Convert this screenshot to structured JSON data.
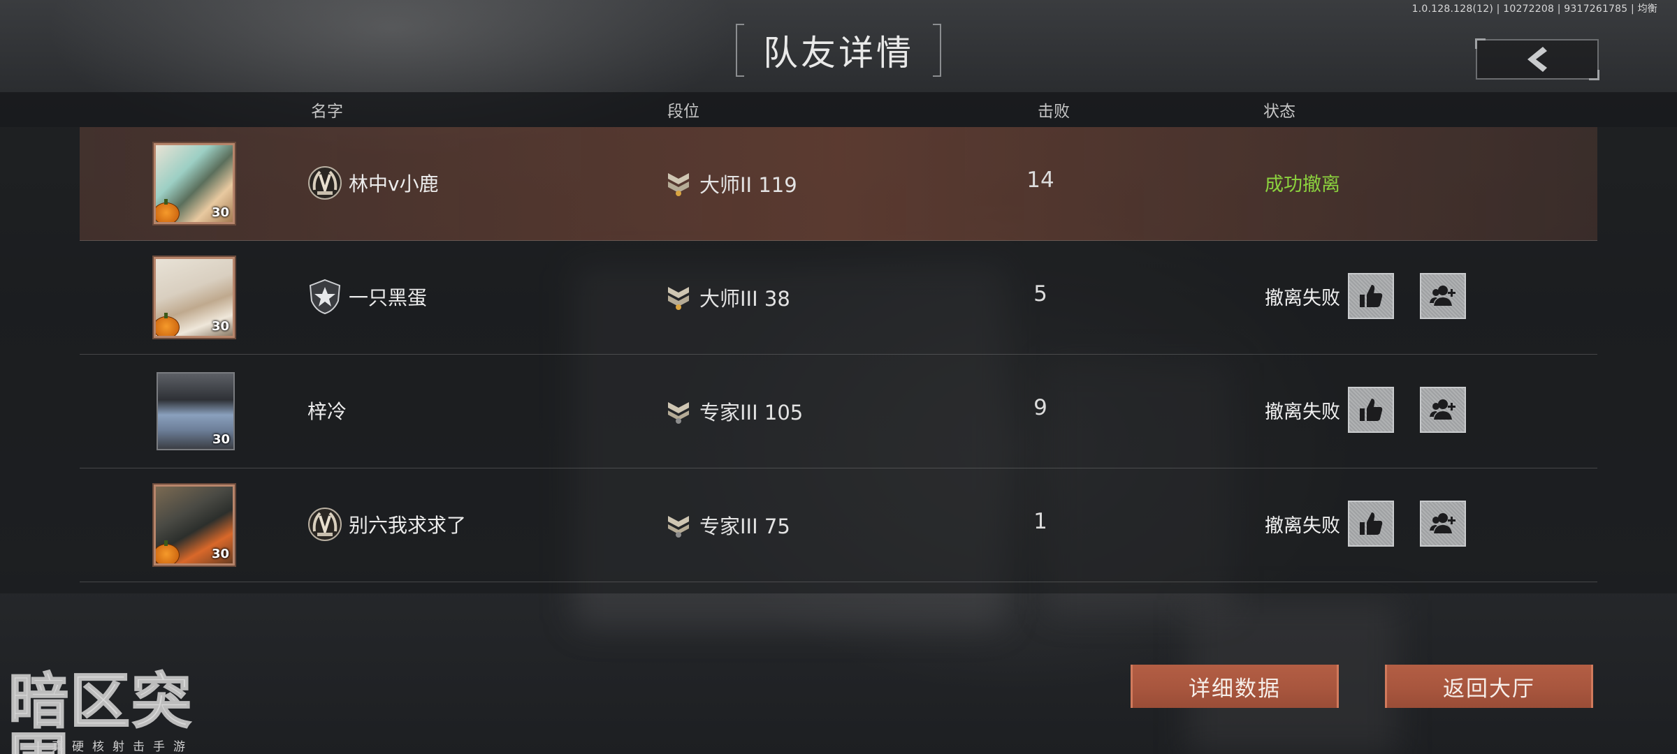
{
  "version_info": "1.0.128.128(12) | 10272208 | 9317261785 | 均衡",
  "title": "队友详情",
  "back_icon": "chevron-left-icon",
  "columns": {
    "name": "名字",
    "rank": "段位",
    "kills": "击败",
    "status": "状态"
  },
  "players": [
    {
      "name": "林中v小鹿",
      "badge_icon": "laurel-badge-icon",
      "level": "30",
      "rank": "大师II 119",
      "kills": "14",
      "status": "成功撤离",
      "status_color": "#8bd23e",
      "highlighted": true,
      "has_actions": false
    },
    {
      "name": "一只黑蛋",
      "badge_icon": "star-shield-badge-icon",
      "level": "30",
      "rank": "大师III 38",
      "kills": "5",
      "status": "撤离失败",
      "highlighted": false,
      "has_actions": true
    },
    {
      "name": "梓冷",
      "badge_icon": "",
      "level": "30",
      "rank": "专家III 105",
      "kills": "9",
      "status": "撤离失败",
      "highlighted": false,
      "has_actions": true
    },
    {
      "name": "别六我求求了",
      "badge_icon": "laurel-badge-icon",
      "level": "30",
      "rank": "专家III 75",
      "kills": "1",
      "status": "撤离失败",
      "highlighted": false,
      "has_actions": true
    }
  ],
  "actions": {
    "like_icon": "thumbs-up-icon",
    "add_friend_icon": "add-friend-icon"
  },
  "buttons": {
    "detail": "详细数据",
    "lobby": "返回大厅"
  },
  "logo": {
    "title": "暗区突围",
    "subtitle": "真硬核射击手游"
  },
  "colors": {
    "accent_button": "#a8563e",
    "success": "#8bd23e",
    "highlight_row": "#8c503c"
  }
}
